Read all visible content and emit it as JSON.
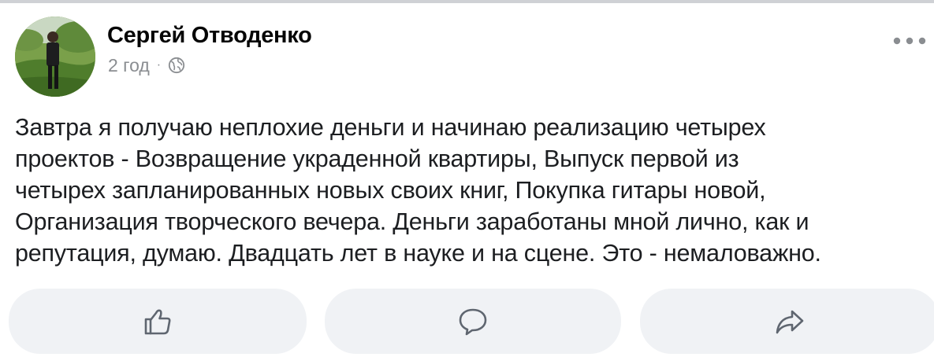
{
  "post": {
    "author_name": "Сергей Отводенко",
    "time": "2 год",
    "separator": "·",
    "privacy_icon": "globe-icon",
    "more_icon": "ellipsis-icon",
    "text": "Завтра я получаю неплохие деньги и начинаю реализацию четырех\nпроектов - Возвращение украденной квартиры, Выпуск первой из\nчетырех запланированных новых своих книг, Покупка гитары новой,\nОрганизация творческого вечера. Деньги заработаны мной лично, как и\nрепутация, думаю. Двадцать лет в науке и на сцене. Это - немаловажно."
  },
  "actions": [
    {
      "icon": "like-icon"
    },
    {
      "icon": "comment-icon"
    },
    {
      "icon": "share-icon"
    }
  ],
  "colors": {
    "muted_text": "#8a8d91",
    "button_bg": "#f0f2f5",
    "icon_stroke": "#5f6670"
  }
}
